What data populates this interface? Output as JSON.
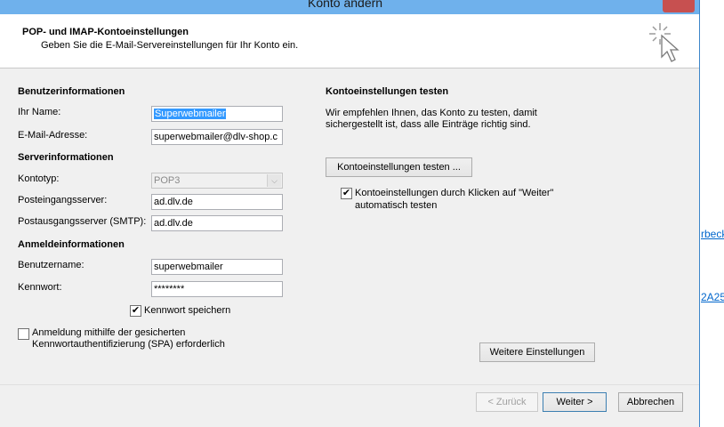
{
  "window": {
    "title": "Konto ändern"
  },
  "header": {
    "title": "POP- und IMAP-Kontoeinstellungen",
    "subtitle": "Geben Sie die E-Mail-Servereinstellungen für Ihr Konto ein."
  },
  "user_info": {
    "section": "Benutzerinformationen",
    "name_label": "Ihr Name:",
    "name_value": "Superwebmailer",
    "email_label": "E-Mail-Adresse:",
    "email_value": "superwebmailer@dlv-shop.c"
  },
  "server_info": {
    "section": "Serverinformationen",
    "account_type_label": "Kontotyp:",
    "account_type_value": "POP3",
    "incoming_label": "Posteingangsserver:",
    "incoming_value": "ad.dlv.de",
    "outgoing_label": "Postausgangsserver (SMTP):",
    "outgoing_value": "ad.dlv.de"
  },
  "login_info": {
    "section": "Anmeldeinformationen",
    "username_label": "Benutzername:",
    "username_value": "superwebmailer",
    "password_label": "Kennwort:",
    "password_value": "********",
    "save_password_label": "Kennwort speichern",
    "save_password_checked": true,
    "spa_label_line1": "Anmeldung mithilfe der gesicherten",
    "spa_label_line2": "Kennwortauthentifizierung (SPA) erforderlich",
    "spa_checked": false
  },
  "test_settings": {
    "section": "Kontoeinstellungen testen",
    "desc_line1": "Wir empfehlen Ihnen, das Konto zu testen, damit",
    "desc_line2": "sichergestellt ist, dass alle Einträge richtig sind.",
    "test_button": "Kontoeinstellungen testen ...",
    "auto_test_line1": "Kontoeinstellungen durch Klicken auf \"Weiter\"",
    "auto_test_line2": "automatisch testen",
    "auto_test_checked": true,
    "more_settings_button": "Weitere Einstellungen"
  },
  "footer": {
    "back_button": "< Zurück",
    "next_button": "Weiter >",
    "cancel_button": "Abbrechen"
  },
  "background": {
    "link1": "rbeck",
    "link2": "2A25"
  },
  "colors": {
    "titlebar": "#6fb1ec",
    "close_button": "#c75050",
    "selection": "#3399ff",
    "link": "#0066cc"
  },
  "icons": {
    "header_icon": "sparkle-cursor-icon",
    "check": "checkmark-icon",
    "combo_arrow": "chevron-down-icon"
  }
}
